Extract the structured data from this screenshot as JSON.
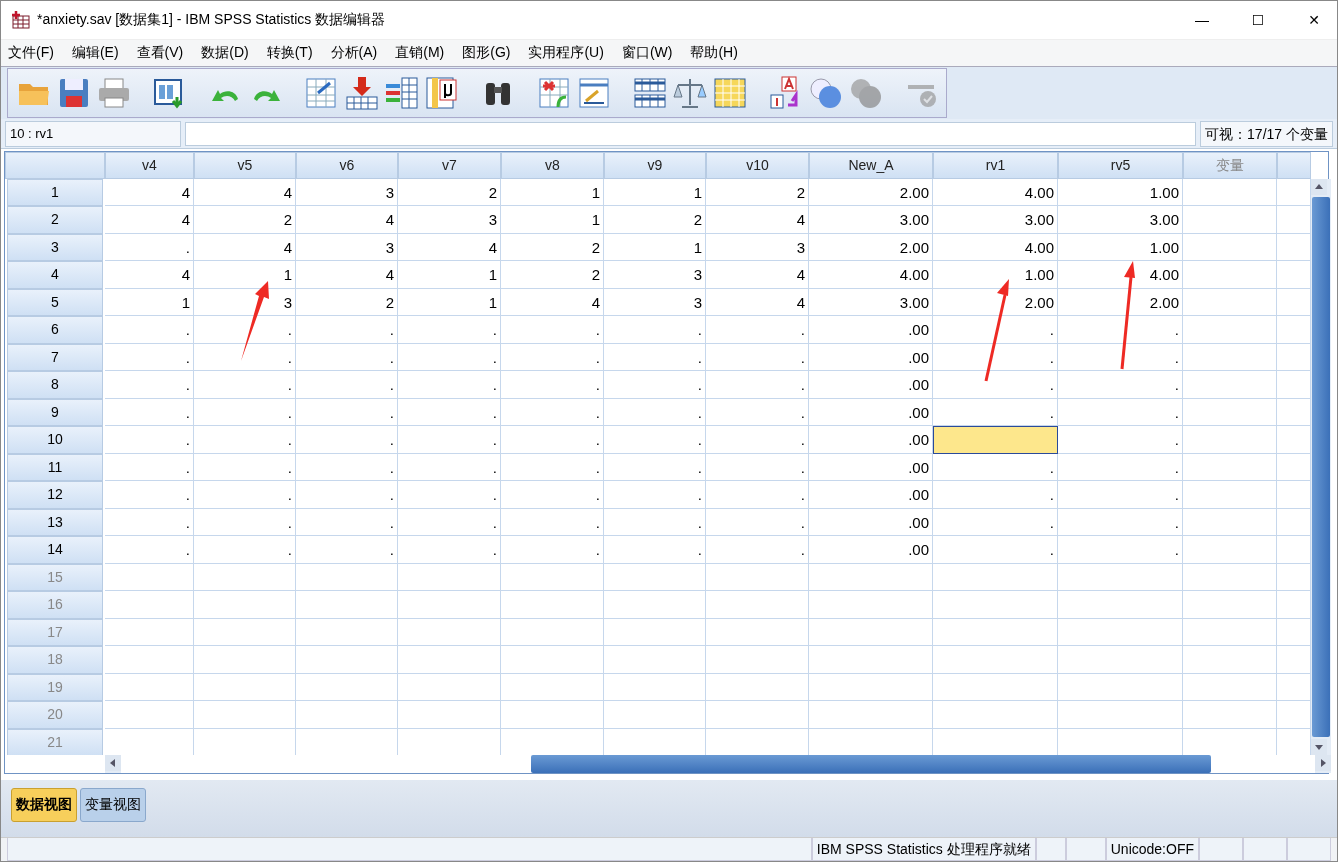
{
  "window": {
    "title": "*anxiety.sav [数据集1] - IBM SPSS Statistics 数据编辑器",
    "controls": [
      "—",
      "☐",
      "✕"
    ]
  },
  "menu": [
    "文件(F)",
    "编辑(E)",
    "查看(V)",
    "数据(D)",
    "转换(T)",
    "分析(A)",
    "直销(M)",
    "图形(G)",
    "实用程序(U)",
    "窗口(W)",
    "帮助(H)"
  ],
  "cell_ref": "10 : rv1",
  "visible_count": "可视：17/17 个变量",
  "table": {
    "columns": [
      {
        "name": "v4",
        "disabled": false
      },
      {
        "name": "v5",
        "disabled": false
      },
      {
        "name": "v6",
        "disabled": false
      },
      {
        "name": "v7",
        "disabled": false
      },
      {
        "name": "v8",
        "disabled": false
      },
      {
        "name": "v9",
        "disabled": false
      },
      {
        "name": "v10",
        "disabled": false
      },
      {
        "name": "New_A",
        "disabled": false
      },
      {
        "name": "rv1",
        "disabled": false
      },
      {
        "name": "rv5",
        "disabled": false
      },
      {
        "name": "变量",
        "disabled": true
      }
    ],
    "rows": [
      {
        "label": "1",
        "disabled": false,
        "cells": [
          "4",
          "4",
          "3",
          "2",
          "1",
          "1",
          "2",
          "2.00",
          "4.00",
          "1.00"
        ]
      },
      {
        "label": "2",
        "disabled": false,
        "cells": [
          "4",
          "2",
          "4",
          "3",
          "1",
          "2",
          "4",
          "3.00",
          "3.00",
          "3.00"
        ]
      },
      {
        "label": "3",
        "disabled": false,
        "cells": [
          ".",
          "4",
          "3",
          "4",
          "2",
          "1",
          "3",
          "2.00",
          "4.00",
          "1.00"
        ]
      },
      {
        "label": "4",
        "disabled": false,
        "cells": [
          "4",
          "1",
          "4",
          "1",
          "2",
          "3",
          "4",
          "4.00",
          "1.00",
          "4.00"
        ]
      },
      {
        "label": "5",
        "disabled": false,
        "cells": [
          "1",
          "3",
          "2",
          "1",
          "4",
          "3",
          "4",
          "3.00",
          "2.00",
          "2.00"
        ]
      },
      {
        "label": "6",
        "disabled": false,
        "cells": [
          ".",
          ".",
          ".",
          ".",
          ".",
          ".",
          ".",
          ".00",
          ".",
          "."
        ]
      },
      {
        "label": "7",
        "disabled": false,
        "cells": [
          ".",
          ".",
          ".",
          ".",
          ".",
          ".",
          ".",
          ".00",
          ".",
          "."
        ]
      },
      {
        "label": "8",
        "disabled": false,
        "cells": [
          ".",
          ".",
          ".",
          ".",
          ".",
          ".",
          ".",
          ".00",
          ".",
          "."
        ]
      },
      {
        "label": "9",
        "disabled": false,
        "cells": [
          ".",
          ".",
          ".",
          ".",
          ".",
          ".",
          ".",
          ".00",
          ".",
          "."
        ]
      },
      {
        "label": "10",
        "disabled": false,
        "cells": [
          ".",
          ".",
          ".",
          ".",
          ".",
          ".",
          ".",
          ".00",
          {
            "selected": true
          },
          "."
        ]
      },
      {
        "label": "11",
        "disabled": false,
        "cells": [
          ".",
          ".",
          ".",
          ".",
          ".",
          ".",
          ".",
          ".00",
          ".",
          "."
        ]
      },
      {
        "label": "12",
        "disabled": false,
        "cells": [
          ".",
          ".",
          ".",
          ".",
          ".",
          ".",
          ".",
          ".00",
          ".",
          "."
        ]
      },
      {
        "label": "13",
        "disabled": false,
        "cells": [
          ".",
          ".",
          ".",
          ".",
          ".",
          ".",
          ".",
          ".00",
          ".",
          "."
        ]
      },
      {
        "label": "14",
        "disabled": false,
        "cells": [
          ".",
          ".",
          ".",
          ".",
          ".",
          ".",
          ".",
          ".00",
          ".",
          "."
        ]
      },
      {
        "label": "15",
        "disabled": true
      },
      {
        "label": "16",
        "disabled": true
      },
      {
        "label": "17",
        "disabled": true
      },
      {
        "label": "18",
        "disabled": true
      },
      {
        "label": "19",
        "disabled": true
      },
      {
        "label": "20",
        "disabled": true
      },
      {
        "label": "21",
        "disabled": true
      }
    ]
  },
  "view_tabs": [
    {
      "label": "数据视图",
      "selected": true
    },
    {
      "label": "变量视图",
      "selected": false
    }
  ],
  "status_bar": [
    "IBM SPSS Statistics 处理程序就绪",
    "Unicode:OFF"
  ]
}
